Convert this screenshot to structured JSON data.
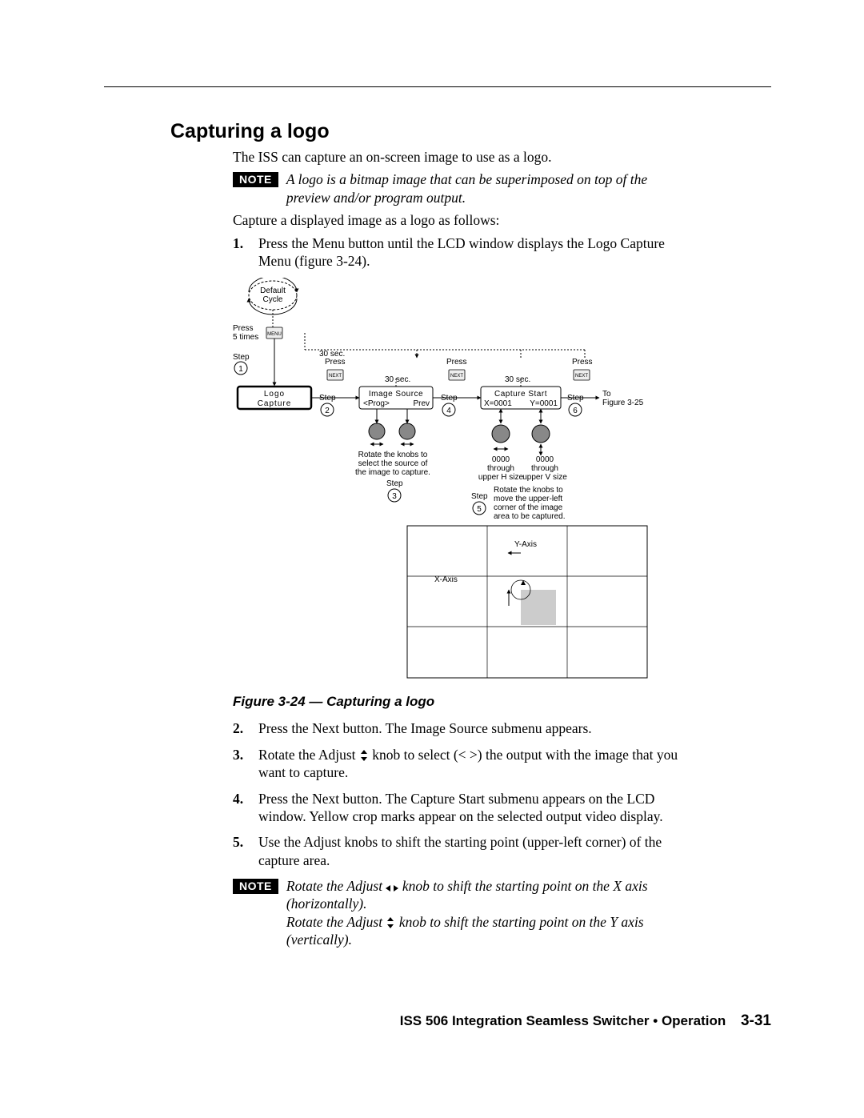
{
  "heading": "Capturing a logo",
  "intro_text": "The ISS can capture an on-screen image to use as a logo.",
  "note_label": "NOTE",
  "note1_text": "A logo is a bitmap image that can be superimposed on top of the preview and/or program output.",
  "lead_text": "Capture a displayed image as a logo as follows:",
  "steps_top": [
    {
      "n": "1",
      "t": "Press the Menu button until the LCD window displays the Logo Capture Menu (figure 3-24)."
    }
  ],
  "figure": {
    "caption": "Figure 3-24 — Capturing a logo",
    "labels": {
      "default_cycle": "Default\nCycle",
      "press_5_times": "Press\n5 times",
      "menu_btn": "MENU",
      "thirty_sec": "30 sec.",
      "step": "Step",
      "press": "Press",
      "next_btn": "NEXT",
      "to_fig": "To\nFigure 3-25",
      "lcd_logo": "Logo\nCapture",
      "lcd_img_src_l1": "Image Source",
      "lcd_img_src_l2": "<Prog>        Prev",
      "lcd_cap_l1": "Capture Start",
      "lcd_cap_l2": "X=0001    Y=0001",
      "rotate_source": "Rotate the knobs to\nselect the source of\nthe image to capture.",
      "h_range": "0000\nthrough\nupper H size",
      "v_range": "0000\nthrough\nupper V size",
      "rotate_corner": "Rotate the knobs to\nmove the upper-left\ncorner of the image\narea to be captured.",
      "x_axis": "X-Axis",
      "y_axis": "Y-Axis"
    }
  },
  "steps_bottom": [
    {
      "n": "2",
      "t": "Press the Next button.  The Image Source submenu appears."
    },
    {
      "n": "3",
      "t_pre": "Rotate the Adjust ",
      "icon": "vert",
      "t_post": " knob to select (< >) the output with the image that you want to capture."
    },
    {
      "n": "4",
      "t": "Press the Next button.  The Capture Start submenu appears on the LCD window.  Yellow crop marks appear on the selected output video display."
    },
    {
      "n": "5",
      "t": "Use the Adjust knobs to shift the starting point (upper-left corner) of the capture area."
    }
  ],
  "note2_line1_pre": "Rotate the Adjust ",
  "note2_line1_post": " knob to shift the starting point on the X axis (horizontally).",
  "note2_line2_pre": "Rotate the Adjust ",
  "note2_line2_post": " knob to shift the starting point on the Y axis (vertically).",
  "footer_text": "ISS 506 Integration Seamless Switcher • Operation",
  "page_num": "3-31"
}
